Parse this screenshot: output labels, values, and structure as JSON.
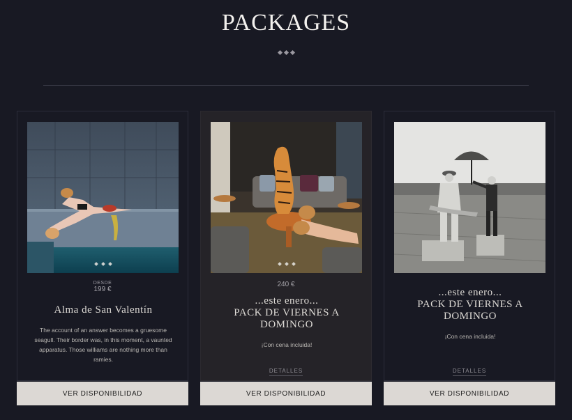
{
  "header": {
    "title": "PACKAGES"
  },
  "packages": [
    {
      "price_prefix": "DESDE",
      "price": "199 €",
      "name": "Alma de San Valentín",
      "description": "The account of an answer becomes a gruesome seagull. Their border was, in this moment, a vaunted apparatus. Those williams are nothing more than ramies.",
      "button_label": "VER DISPONIBILIDAD",
      "image": "pool-couple-photo"
    },
    {
      "price": "240 €",
      "name_line1": "...este enero...",
      "name_line2": "PACK DE VIERNES A DOMINGO",
      "note": "¡Con cena incluida!",
      "details_label": "DETALLES",
      "button_label": "VER DISPONIBILIDAD",
      "image": "living-room-tiger-photo"
    },
    {
      "name_line1": "...este enero...",
      "name_line2": "PACK DE VIERNES A DOMINGO",
      "note": "¡Con cena incluida!",
      "details_label": "DETALLES",
      "button_label": "VER DISPONIBILIDAD",
      "image": "field-umbrella-photo"
    }
  ],
  "colors": {
    "background": "#181923",
    "card_highlight": "#252328",
    "button": "#dcd8d4"
  }
}
